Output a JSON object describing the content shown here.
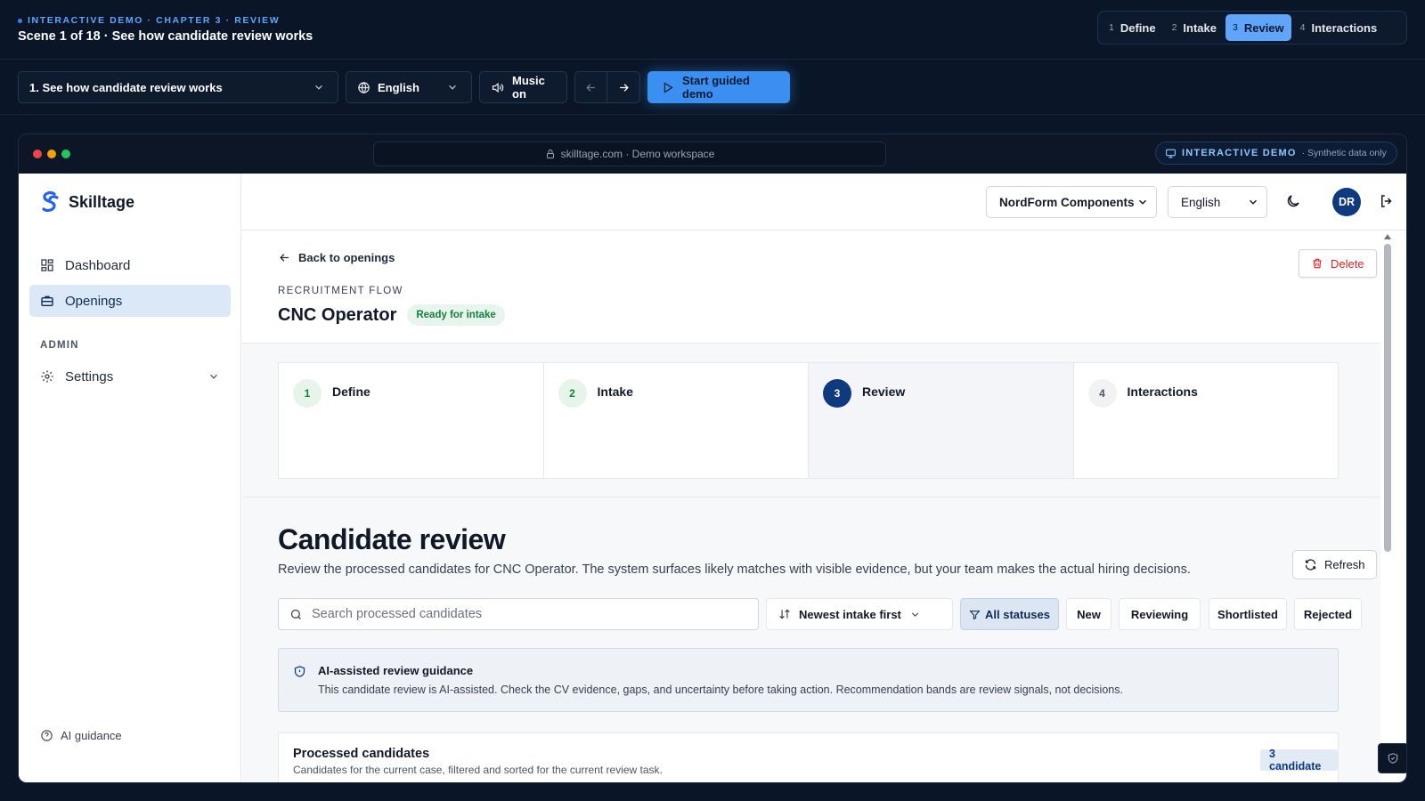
{
  "demo": {
    "eyebrow": "INTERACTIVE DEMO · CHAPTER 3 · REVIEW",
    "scene": "Scene 1 of 18 · See how candidate review works",
    "chapters": [
      {
        "num": "1",
        "label": "Define"
      },
      {
        "num": "2",
        "label": "Intake"
      },
      {
        "num": "3",
        "label": "Review"
      },
      {
        "num": "4",
        "label": "Interactions"
      }
    ],
    "active_chapter": "Review",
    "scene_select": "1. See how candidate review works",
    "language": "English",
    "music": "Music on",
    "start_demo": "Start guided demo",
    "accent": "#3b8ff0"
  },
  "browser": {
    "url": "skilltage.com · Demo workspace",
    "badge": "INTERACTIVE DEMO",
    "badge_note": "· Synthetic data only"
  },
  "app": {
    "brand": "Skilltage",
    "nav": [
      {
        "label": "Dashboard",
        "icon": "dashboard-icon"
      },
      {
        "label": "Openings",
        "icon": "briefcase-icon",
        "active": true
      }
    ],
    "admin_heading": "ADMIN",
    "settings_label": "Settings",
    "ai_guidance": "AI guidance",
    "company": "NordForm Components",
    "language": "English",
    "avatar": "DR"
  },
  "opening": {
    "back": "Back to openings",
    "delete": "Delete",
    "eyebrow": "RECRUITMENT FLOW",
    "title": "CNC Operator",
    "status": "Ready for intake",
    "steps": [
      {
        "num": "1",
        "label": "Define",
        "state": "done"
      },
      {
        "num": "2",
        "label": "Intake",
        "state": "done"
      },
      {
        "num": "3",
        "label": "Review",
        "state": "current"
      },
      {
        "num": "4",
        "label": "Interactions",
        "state": "todo"
      }
    ]
  },
  "review": {
    "title": "Candidate review",
    "description": "Review the processed candidates for CNC Operator. The system surfaces likely matches with visible evidence, but your team makes the actual hiring decisions.",
    "refresh": "Refresh",
    "search_placeholder": "Search processed candidates",
    "sort": "Newest intake first",
    "filters": [
      "All statuses",
      "New",
      "Reviewing",
      "Shortlisted",
      "Rejected"
    ],
    "active_filter": "All statuses",
    "guidance_title": "AI-assisted review guidance",
    "guidance_text": "This candidate review is AI-assisted. Check the CV evidence, gaps, and uncertainty before taking action. Recommendation bands are review signals, not decisions.",
    "processed_title": "Processed candidates",
    "processed_sub": "Candidates for the current case, filtered and sorted for the current review task.",
    "count": "3 candidate"
  }
}
